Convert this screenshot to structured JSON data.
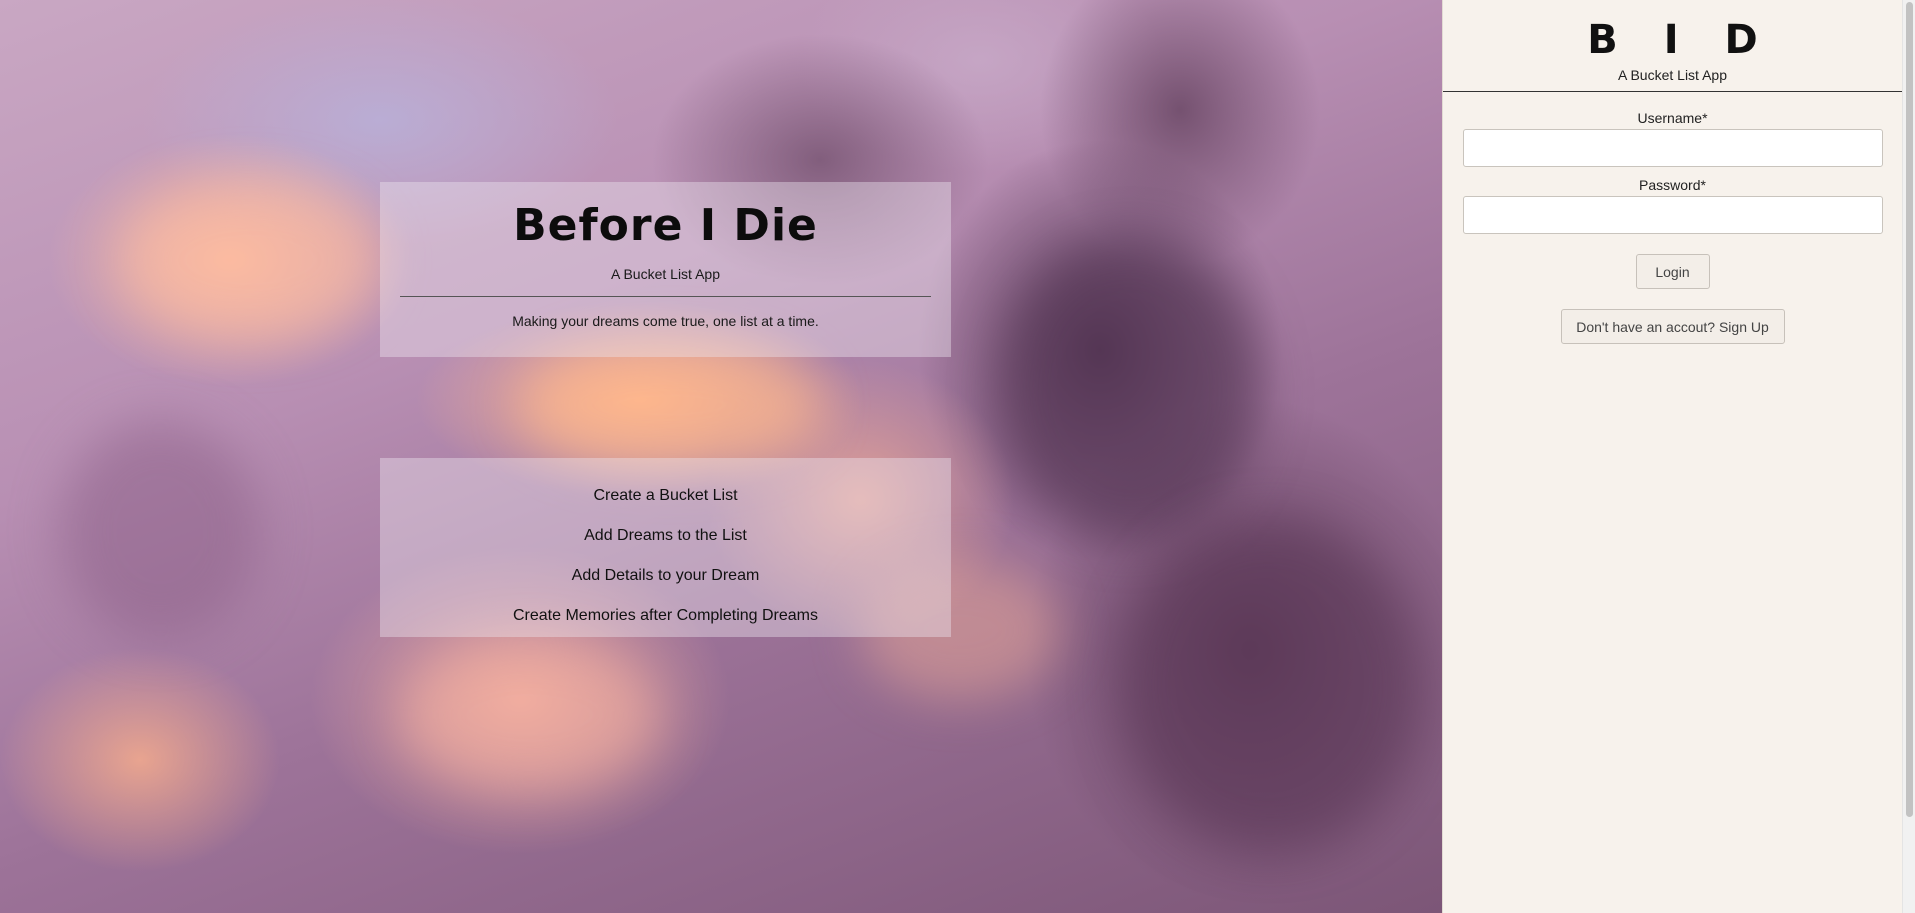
{
  "hero": {
    "title": "Before I Die",
    "subtitle": "A Bucket List App",
    "tagline": "Making your dreams come true, one list at a time."
  },
  "features": [
    "Create a Bucket List",
    "Add Dreams to the List",
    "Add Details to your Dream",
    "Create Memories after Completing Dreams"
  ],
  "sidebar": {
    "logo": "B I D",
    "subtitle": "A Bucket List App",
    "username_label": "Username*",
    "username_value": "",
    "password_label": "Password*",
    "password_value": "",
    "login_label": "Login",
    "signup_label": "Don't have an accout? Sign Up"
  },
  "colors": {
    "sidebar_bg": "#f7f2ec",
    "panel_bg": "rgba(236,228,238,0.42)",
    "sky_pink": "#f3b39c",
    "sky_purple": "#6e4a6c"
  }
}
